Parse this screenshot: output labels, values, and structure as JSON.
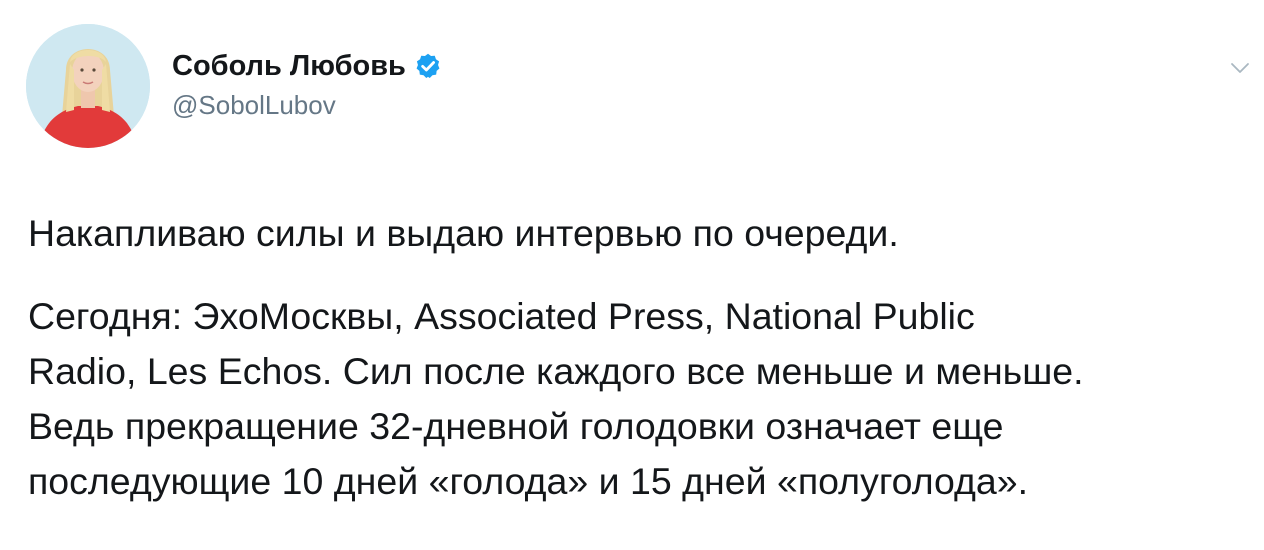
{
  "tweet": {
    "author": {
      "name": "Соболь Любовь",
      "handle": "@SobolLubov",
      "verified": true
    },
    "text": {
      "paragraph1": "Накапливаю силы и выдаю интервью по очереди.",
      "paragraph2_lines": [
        "Сегодня: ЭхоМосквы, Associated Press, National Public",
        "Radio, Les Echos. Сил после каждого все меньше и меньше.",
        "Ведь прекращение 32-дневной голодовки означает еще",
        "последующие 10 дней «голода» и 15 дней «полуголода»."
      ]
    },
    "icons": {
      "verified_badge": "verified-badge-icon",
      "menu": "chevron-down-icon"
    },
    "colors": {
      "text": "#14171a",
      "secondary": "#657786",
      "verified": "#1da1f2",
      "chevron": "#aab8c2"
    }
  }
}
